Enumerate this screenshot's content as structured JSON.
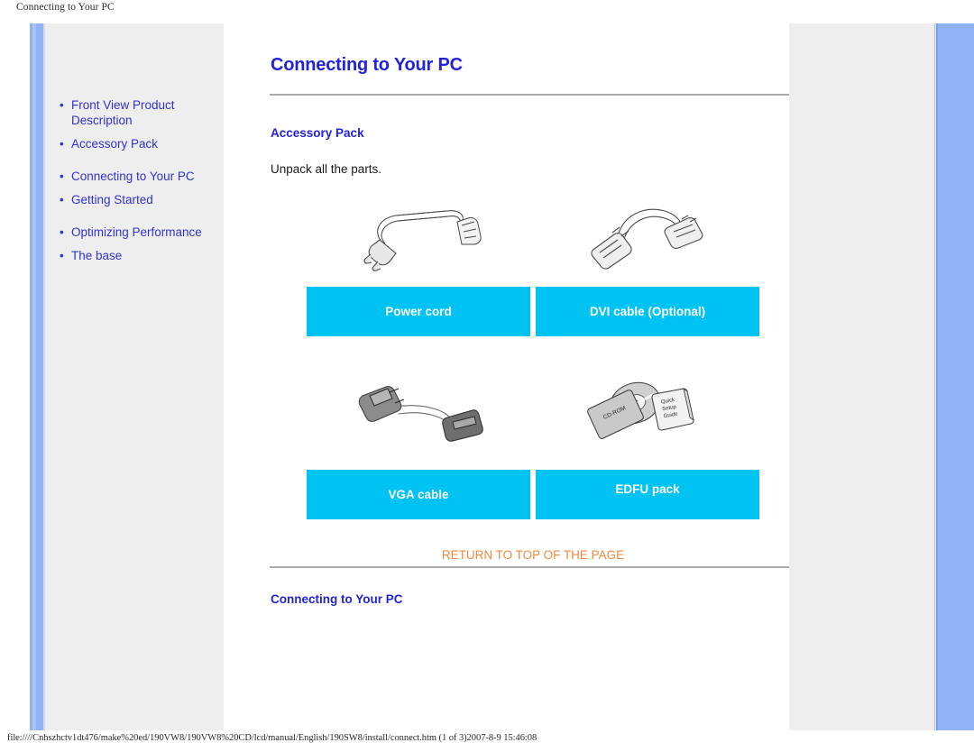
{
  "print_header": "Connecting to Your PC",
  "print_footer": "file:////Cnhszhctv1dt476/make%20ed/190VW8/190VW8%20CD/lcd/manual/English/190SW8/install/connect.htm (1 of 3)2007-8-9 15:46:08",
  "sidebar": {
    "items": [
      {
        "label": "Front View Product Description"
      },
      {
        "label": "Accessory Pack"
      },
      {
        "label": "Connecting to Your PC"
      },
      {
        "label": "Getting Started"
      },
      {
        "label": "Optimizing Performance"
      },
      {
        "label": "The base"
      }
    ],
    "bullet": "•"
  },
  "main": {
    "title": "Connecting to Your PC",
    "section_accessory_pack": "Accessory Pack",
    "intro_text": "Unpack all the parts.",
    "section_connecting": "Connecting to Your PC",
    "return_link": "RETURN TO TOP OF THE PAGE",
    "accessories": [
      {
        "label": "Power cord",
        "icon": "power-cord-image"
      },
      {
        "label": "DVI cable (Optional)",
        "icon": "dvi-cable-image"
      },
      {
        "label": "VGA cable",
        "icon": "vga-cable-image"
      },
      {
        "label": "EDFU pack",
        "icon": "edfu-pack-image"
      }
    ],
    "edfu_labels": {
      "cd_label": "CD-ROM",
      "guide_line1": "Quick",
      "guide_line2": "Setup",
      "guide_line3": "Guide"
    }
  },
  "colors": {
    "link_blue": "#3232cd",
    "heading_blue": "#2222dd",
    "cyan_bar": "#00c2f3",
    "orange_link": "#f08a3c",
    "panel_gray": "#eeeeee",
    "accent_bar_blue": "#8fb2f7"
  }
}
